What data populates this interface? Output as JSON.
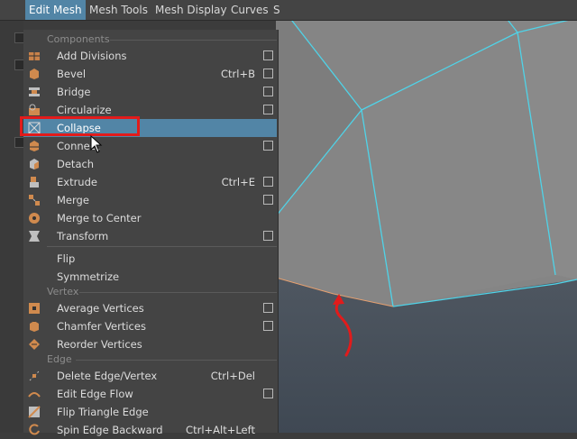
{
  "menubar": {
    "items": [
      "Edit Mesh",
      "Mesh Tools",
      "Mesh Display",
      "Curves",
      "S"
    ],
    "active": "Edit Mesh"
  },
  "menu": {
    "sections": {
      "components": "Components",
      "vertex": "Vertex",
      "edge": "Edge"
    },
    "items": [
      {
        "label": "Add Divisions",
        "shortcut": "",
        "option_box": true
      },
      {
        "label": "Bevel",
        "shortcut": "Ctrl+B",
        "option_box": true
      },
      {
        "label": "Bridge",
        "shortcut": "",
        "option_box": true
      },
      {
        "label": "Circularize",
        "shortcut": "",
        "option_box": true
      },
      {
        "label": "Collapse",
        "shortcut": "",
        "option_box": false,
        "highlighted": true
      },
      {
        "label": "Connect",
        "shortcut": "",
        "option_box": true
      },
      {
        "label": "Detach",
        "shortcut": "",
        "option_box": false
      },
      {
        "label": "Extrude",
        "shortcut": "Ctrl+E",
        "option_box": true
      },
      {
        "label": "Merge",
        "shortcut": "",
        "option_box": true
      },
      {
        "label": "Merge to Center",
        "shortcut": "",
        "option_box": false
      },
      {
        "label": "Transform",
        "shortcut": "",
        "option_box": true
      },
      {
        "label": "Flip",
        "shortcut": "",
        "option_box": false
      },
      {
        "label": "Symmetrize",
        "shortcut": "",
        "option_box": false
      },
      {
        "label": "Average Vertices",
        "shortcut": "",
        "option_box": true
      },
      {
        "label": "Chamfer Vertices",
        "shortcut": "",
        "option_box": true
      },
      {
        "label": "Reorder Vertices",
        "shortcut": "",
        "option_box": false
      },
      {
        "label": "Delete Edge/Vertex",
        "shortcut": "Ctrl+Del",
        "option_box": false
      },
      {
        "label": "Edit Edge Flow",
        "shortcut": "",
        "option_box": true
      },
      {
        "label": "Flip Triangle Edge",
        "shortcut": "",
        "option_box": false
      },
      {
        "label": "Spin Edge Backward",
        "shortcut": "Ctrl+Alt+Left",
        "option_box": false
      }
    ]
  },
  "colors": {
    "highlight": "#5285a6",
    "annotation": "#e21b1b",
    "wireframe": "#4fd3e8"
  },
  "icons": {
    "menu_item": "maya-mesh-tool-icon",
    "cursor": "mouse-pointer-icon",
    "annotation_arrow": "red-curved-arrow"
  }
}
